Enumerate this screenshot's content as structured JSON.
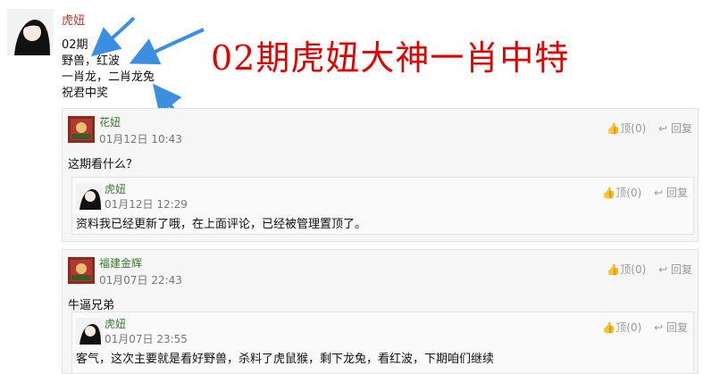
{
  "post": {
    "author": "虎妞",
    "lines": [
      "02期",
      "野兽，红波",
      "一肖龙，二肖龙兔",
      "祝君中奖"
    ]
  },
  "headline": "02期虎妞大神一肖中特",
  "replies": [
    {
      "author": "花妞",
      "time": "01月12日 10:43",
      "text": "这期看什么？",
      "like_label": "顶(0)",
      "reply_label": "回复",
      "sub": {
        "author": "虎妞",
        "time": "01月12日 12:29",
        "text": "资料我已经更新了哦，在上面评论，已经被管理置顶了。",
        "like_label": "顶(0)",
        "reply_label": "回复"
      }
    },
    {
      "author": "福建金辉",
      "time": "01月07日 22:43",
      "text": "牛逼兄弟",
      "like_label": "顶(0)",
      "reply_label": "回复",
      "sub": {
        "author": "虎妞",
        "time": "01月07日 23:55",
        "text": "客气，这次主要就是看好野兽，杀料了虎鼠猴，剩下龙兔，看红波，下期咱们继续",
        "like_label": "顶(0)",
        "reply_label": "回复"
      }
    }
  ],
  "icons": {
    "like": "thumbs-up-icon",
    "reply": "reply-arrow-icon"
  },
  "colors": {
    "headline": "#e00000",
    "author": "#c0392b",
    "reply_author": "#3a7a2e",
    "arrow": "#3b8fe0"
  }
}
